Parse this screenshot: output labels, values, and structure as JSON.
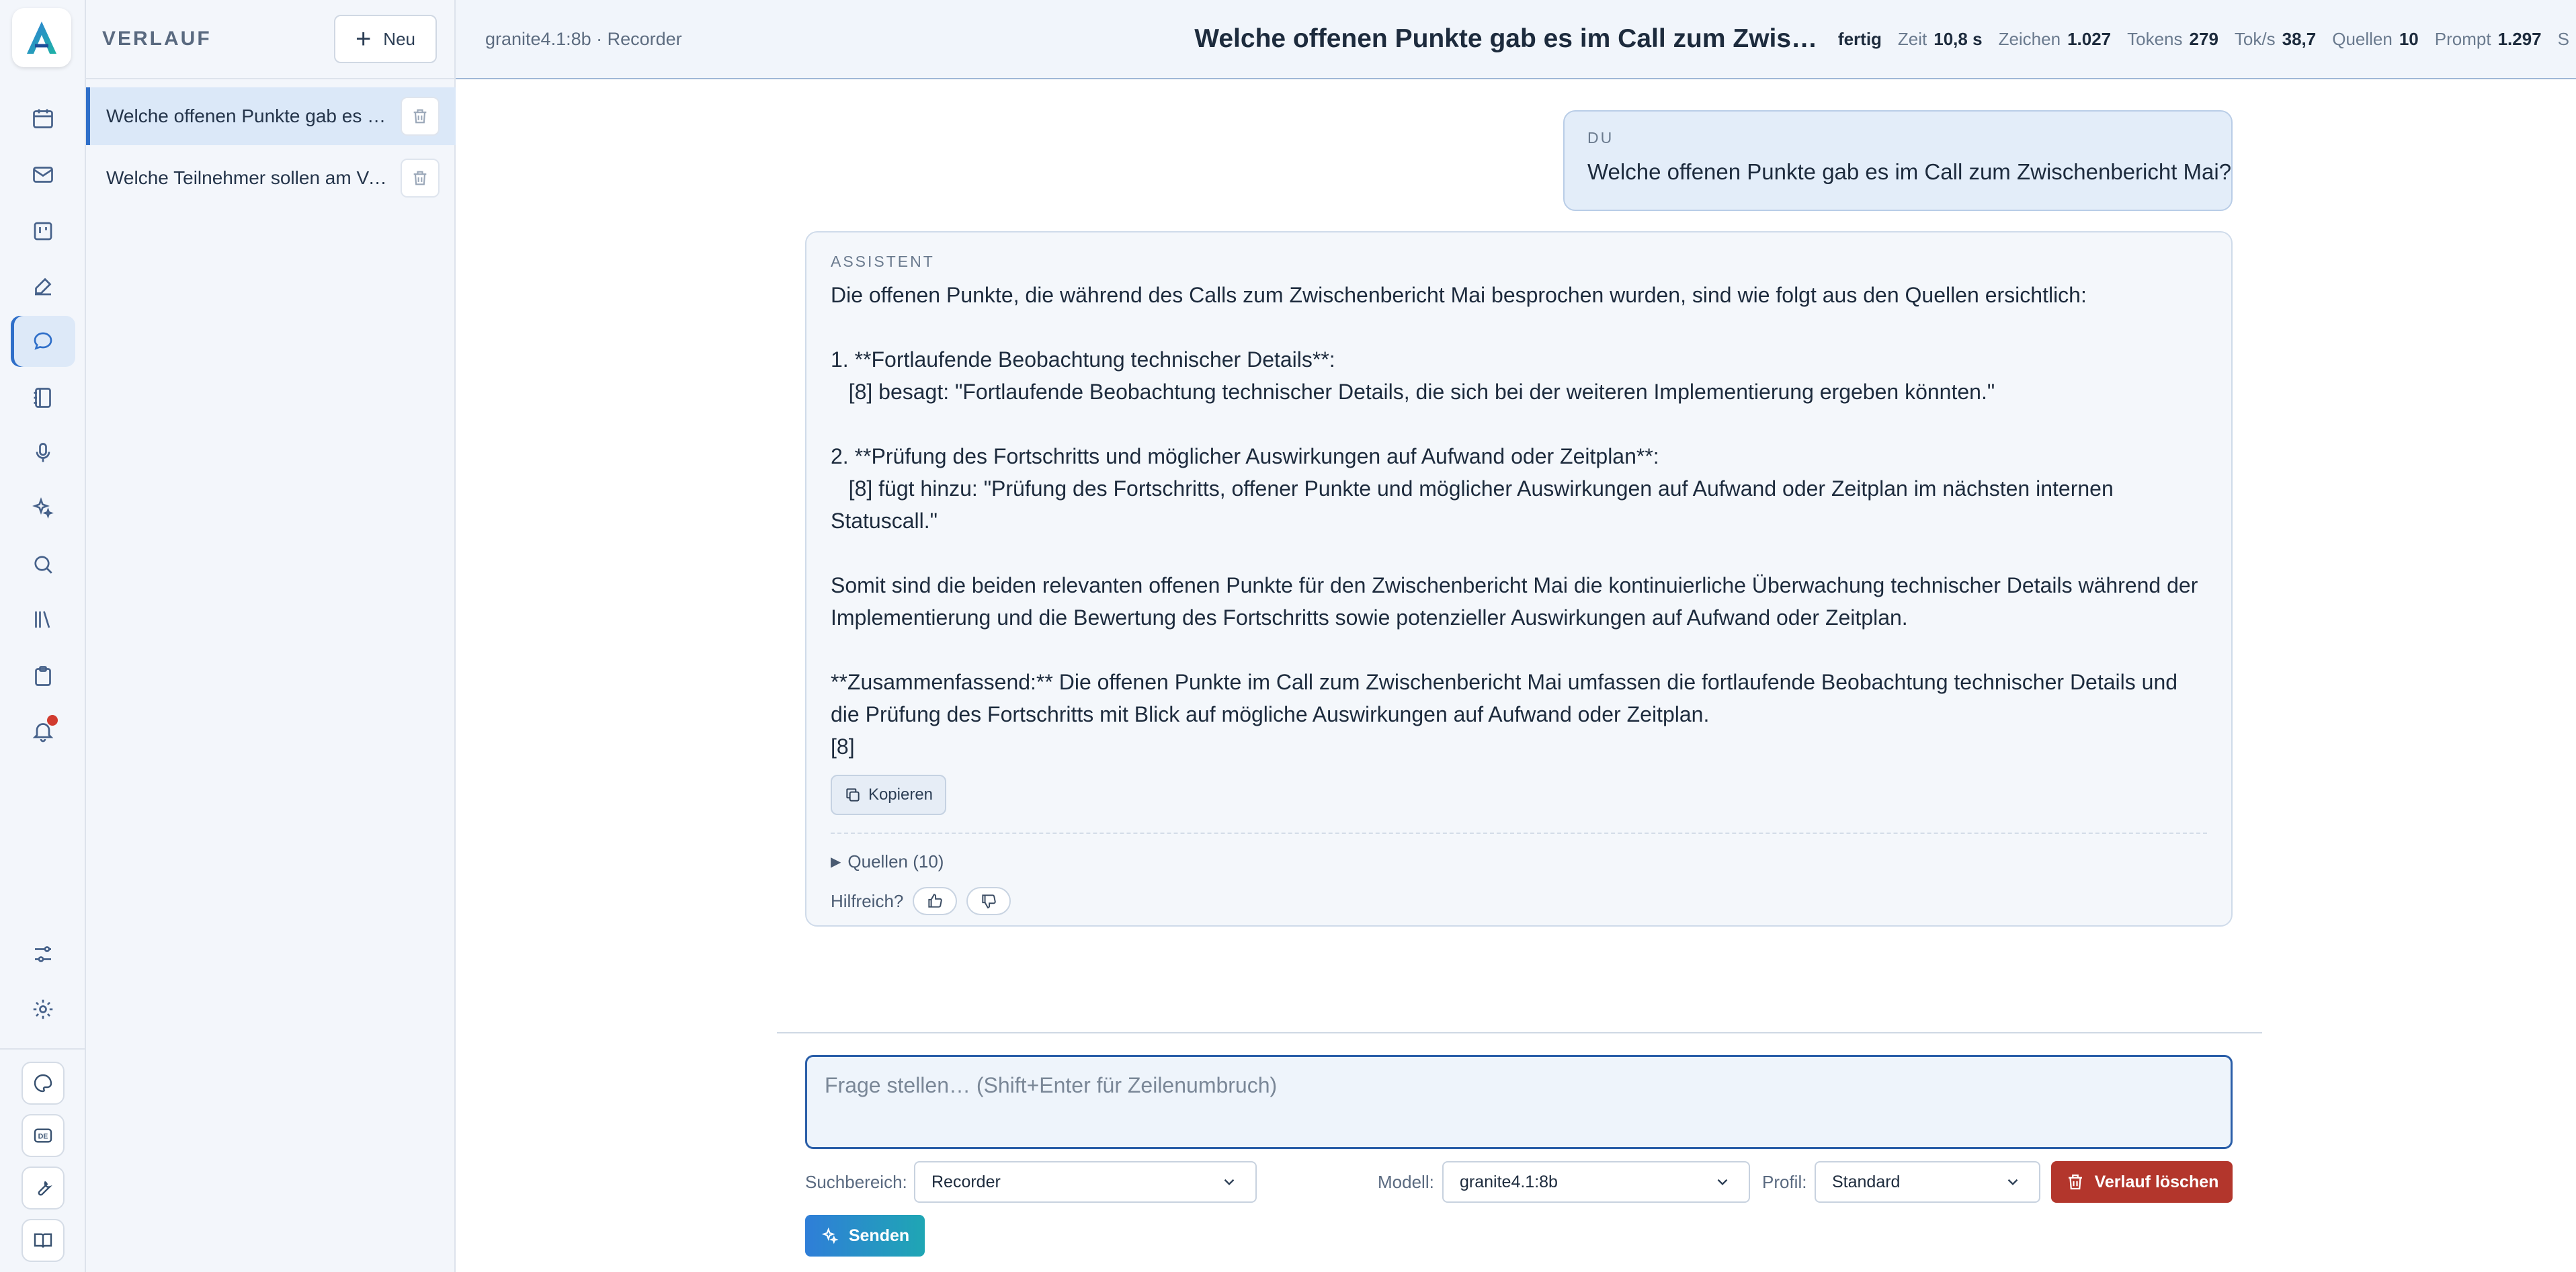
{
  "rail": {
    "icons": [
      "calendar-icon",
      "mail-icon",
      "kanban-icon",
      "edit-icon",
      "chat-icon",
      "notebook-icon",
      "microphone-icon",
      "sparkles-icon",
      "search-icon",
      "library-icon",
      "clipboard-icon",
      "bell-icon",
      "sliders-icon",
      "gear-icon"
    ],
    "bottom": [
      "palette-icon",
      "language-de-icon",
      "wrench-icon",
      "book-icon"
    ],
    "language_badge": "DE",
    "active": "chat-icon"
  },
  "history": {
    "title": "VERLAUF",
    "new_label": "Neu",
    "items": [
      {
        "label": "Welche offenen Punkte gab es im Call zum Zwischenbericht Mai?",
        "active": true
      },
      {
        "label": "Welche Teilnehmer sollen am Vorbereitungstermin teilnehmen?",
        "active": false
      }
    ]
  },
  "topbar": {
    "model_crumb": "granite4.1:8b · Recorder",
    "chat_title": "Welche offenen Punkte gab es im Call zum Zwischenbericht Mai?",
    "status": "fertig",
    "stats": [
      {
        "key": "Zeit",
        "value": "10,8 s"
      },
      {
        "key": "Zeichen",
        "value": "1.027"
      },
      {
        "key": "Tokens",
        "value": "279"
      },
      {
        "key": "Tok/s",
        "value": "38,7"
      },
      {
        "key": "Quellen",
        "value": "10"
      },
      {
        "key": "Prompt",
        "value": "1.297"
      },
      {
        "key": "S",
        "value": ""
      }
    ]
  },
  "conversation": {
    "user": {
      "role": "DU",
      "text": "Welche offenen Punkte gab es im Call zum Zwischenbericht Mai?"
    },
    "assistant": {
      "role": "ASSISTENT",
      "text": "Die offenen Punkte, die während des Calls zum Zwischenbericht Mai besprochen wurden, sind wie folgt aus den Quellen ersichtlich:\n\n1. **Fortlaufende Beobachtung technischer Details**:\n   [8] besagt: \"Fortlaufende Beobachtung technischer Details, die sich bei der weiteren Implementierung ergeben könnten.\"\n\n2. **Prüfung des Fortschritts und möglicher Auswirkungen auf Aufwand oder Zeitplan**:\n   [8] fügt hinzu: \"Prüfung des Fortschritts, offener Punkte und möglicher Auswirkungen auf Aufwand oder Zeitplan im nächsten internen Statuscall.\"\n\nSomit sind die beiden relevanten offenen Punkte für den Zwischenbericht Mai die kontinuierliche Überwachung technischer Details während der Implementierung und die Bewertung des Fortschritts sowie potenzieller Auswirkungen auf Aufwand oder Zeitplan.\n\n**Zusammenfassend:** Die offenen Punkte im Call zum Zwischenbericht Mai umfassen die fortlaufende Beobachtung technischer Details und die Prüfung des Fortschritts mit Blick auf mögliche Auswirkungen auf Aufwand oder Zeitplan.\n[8]",
      "copy_label": "Kopieren",
      "sources_label": "Quellen (10)",
      "helpful_label": "Hilfreich?"
    }
  },
  "composer": {
    "placeholder": "Frage stellen… (Shift+Enter für Zeilenumbruch)",
    "value": "",
    "scope_label": "Suchbereich:",
    "scope_value": "Recorder",
    "model_label": "Modell:",
    "model_value": "granite4.1:8b",
    "profile_label": "Profil:",
    "profile_value": "Standard",
    "clear_label": "Verlauf löschen",
    "send_label": "Senden"
  },
  "colors": {
    "accent": "#2f6fc9",
    "danger": "#b3362c",
    "send_gradient_start": "#2f7ed8",
    "send_gradient_end": "#1fa6b4",
    "notification_dot": "#d13b2f"
  }
}
